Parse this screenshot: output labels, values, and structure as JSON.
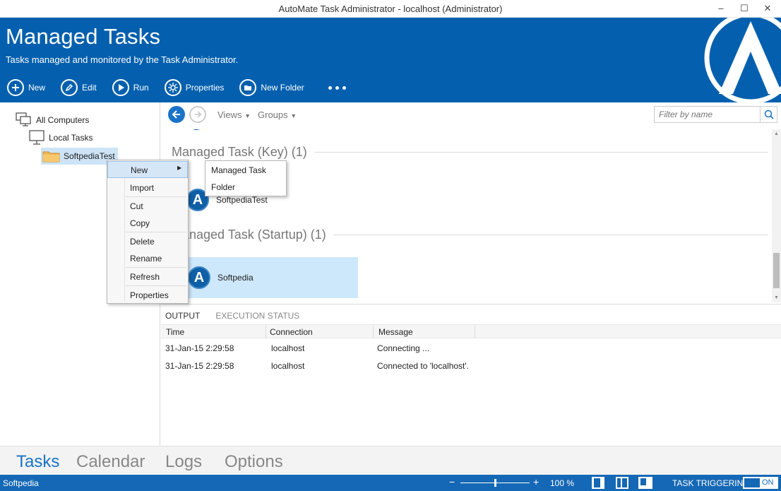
{
  "window": {
    "title": "AutoMate Task Administrator - localhost (Administrator)",
    "minimize": "‒",
    "maximize": "☐",
    "close": "✕"
  },
  "header": {
    "title": "Managed Tasks",
    "subtitle": "Tasks managed and monitored by the Task Administrator.",
    "toolbar": {
      "new": "New",
      "edit": "Edit",
      "run": "Run",
      "properties": "Properties",
      "new_folder": "New Folder"
    },
    "brand_color": "#0460ae"
  },
  "tree": {
    "all_computers": "All Computers",
    "local_tasks": "Local Tasks",
    "folder": "SoftpediaTest"
  },
  "nav": {
    "views": "Views",
    "groups": "Groups",
    "filter_placeholder": "Filter by name"
  },
  "groups": [
    {
      "label": "Managed Task (Key) (1)",
      "task": "SoftpediaTest"
    },
    {
      "label": "Managed Task (Startup) (1)",
      "task": "Softpedia"
    }
  ],
  "output": {
    "tabs": [
      "OUTPUT",
      "EXECUTION STATUS"
    ],
    "columns": [
      "Time",
      "Connection",
      "Message"
    ],
    "rows": [
      {
        "time": "31-Jan-15 2:29:58",
        "connection": "localhost",
        "message": "Connecting ..."
      },
      {
        "time": "31-Jan-15 2:29:58",
        "connection": "localhost",
        "message": "Connected to 'localhost'."
      }
    ]
  },
  "context_menu": {
    "items": [
      "New",
      "Import",
      "Cut",
      "Copy",
      "Delete",
      "Rename",
      "Refresh",
      "Properties"
    ]
  },
  "submenu": {
    "items": [
      "Managed Task",
      "Folder"
    ]
  },
  "bottom_tabs": [
    "Tasks",
    "Calendar",
    "Logs",
    "Options"
  ],
  "status": {
    "left": "Softpedia",
    "zoom_minus": "−",
    "zoom_plus": "+",
    "zoom": "100 %",
    "zoom_level": 0.5,
    "task_triggering": "TASK TRIGGERING",
    "toggle": "ON"
  }
}
